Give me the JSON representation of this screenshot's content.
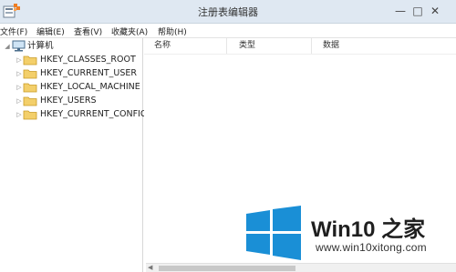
{
  "window": {
    "title": "注册表编辑器",
    "minimize_glyph": "—",
    "maximize_glyph": "□",
    "close_glyph": "✕"
  },
  "menu": [
    "文件(F)",
    "编辑(E)",
    "查看(V)",
    "收藏夹(A)",
    "帮助(H)"
  ],
  "tree": {
    "root": "计算机",
    "items": [
      "HKEY_CLASSES_ROOT",
      "HKEY_CURRENT_USER",
      "HKEY_LOCAL_MACHINE",
      "HKEY_USERS",
      "HKEY_CURRENT_CONFIG"
    ],
    "expanded_glyph": "◢",
    "collapsed_glyph": "▷"
  },
  "list": {
    "columns": [
      "名称",
      "类型",
      "数据"
    ]
  },
  "watermark": {
    "brand": "Win10 之家",
    "url": "www.win10xitong.com",
    "logo_color": "#1a8fd6"
  }
}
